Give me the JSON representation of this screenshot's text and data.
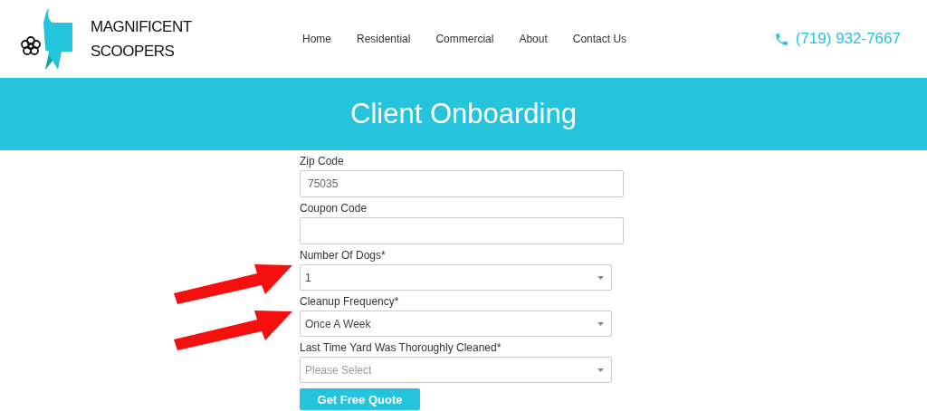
{
  "logo": {
    "lines": [
      "MAGNIFICENT",
      "SCOOPERS"
    ]
  },
  "nav": [
    {
      "label": "Home"
    },
    {
      "label": "Residential"
    },
    {
      "label": "Commercial"
    },
    {
      "label": "About"
    },
    {
      "label": "Contact Us"
    }
  ],
  "phone": "(719) 932-7667",
  "banner": {
    "title": "Client Onboarding"
  },
  "fields": [
    {
      "kind": "text",
      "label": "Zip Code",
      "value": "75035",
      "annotated": false
    },
    {
      "kind": "text",
      "label": "Coupon Code",
      "annotated": false
    },
    {
      "kind": "select",
      "label": "Number Of Dogs*",
      "value": "1",
      "annotated": true
    },
    {
      "kind": "select",
      "label": "Cleanup Frequency*",
      "value": "Once A Week",
      "annotated": true
    },
    {
      "kind": "select",
      "label": "Last Time Yard Was Thoroughly Cleaned*",
      "placeholder": "Please Select",
      "annotated": false
    }
  ],
  "submit": "Get Free Quote"
}
